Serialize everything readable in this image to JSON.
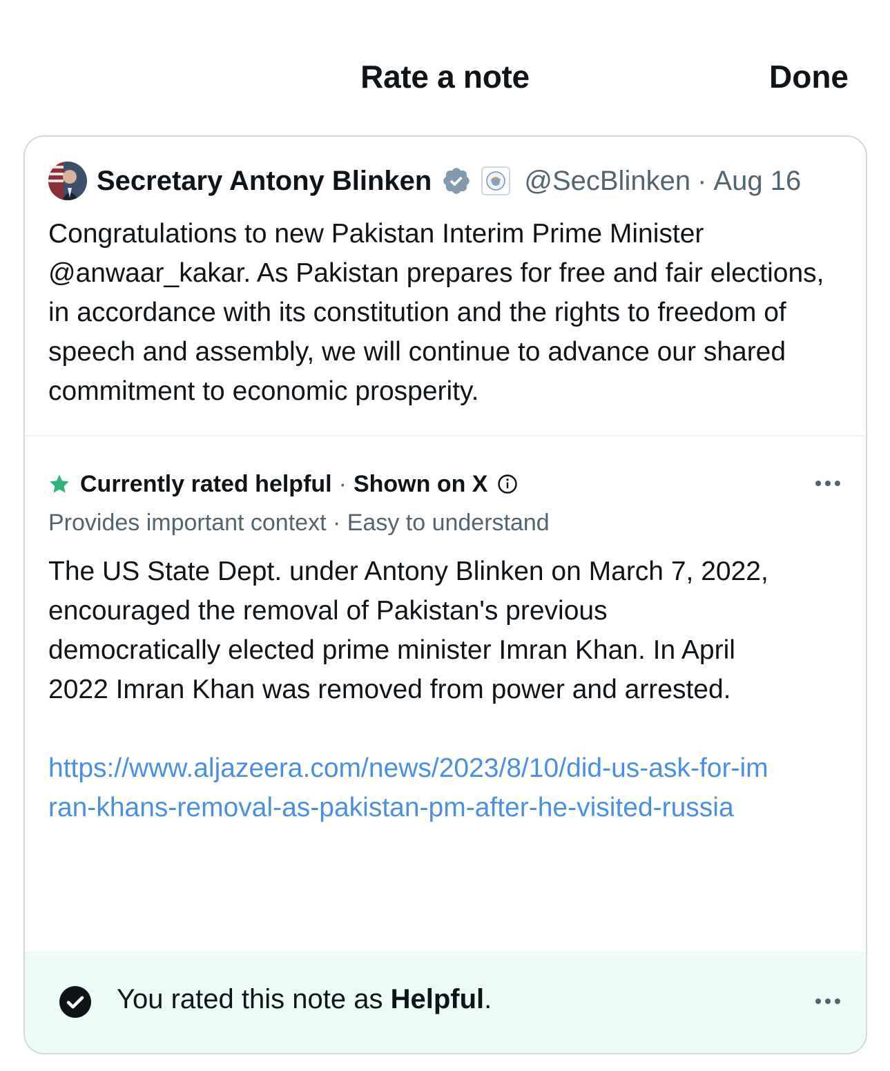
{
  "header": {
    "title": "Rate a note",
    "done_label": "Done"
  },
  "post": {
    "author_name": "Secretary Antony Blinken",
    "handle": "@SecBlinken",
    "separator": "·",
    "date": "Aug 16",
    "text": "Congratulations to new Pakistan Interim Prime Minister @anwaar_kakar. As Pakistan prepares for free and fair elections, in accordance with its constitution and the rights to freedom of speech and assembly, we will continue to advance our shared commitment to economic prosperity.",
    "icons": [
      "avatar",
      "verified-badge-icon",
      "affiliation-seal-icon"
    ]
  },
  "note": {
    "status": "Currently rated helpful",
    "separator": "·",
    "shown": "Shown on X",
    "tags": "Provides important context · Easy to understand",
    "body": "The US State Dept. under Antony Blinken on March 7, 2022, encouraged the removal of Pakistan's previous democratically elected prime minister Imran Khan. In April 2022 Imran Khan was removed from power and arrested.",
    "link": "https://www.aljazeera.com/news/2023/8/10/did-us-ask-for-imran-khans-removal-as-pakistan-pm-after-he-visited-russia",
    "icons": [
      "star-icon",
      "info-icon",
      "more-icon"
    ],
    "colors": {
      "star": "#2fb47d",
      "link": "#4a90e2"
    }
  },
  "rating": {
    "prefix": "You rated this note as ",
    "value": "Helpful",
    "suffix": ".",
    "icons": [
      "check-circle-icon",
      "more-icon"
    ],
    "colors": {
      "background": "#edfbf6"
    }
  }
}
